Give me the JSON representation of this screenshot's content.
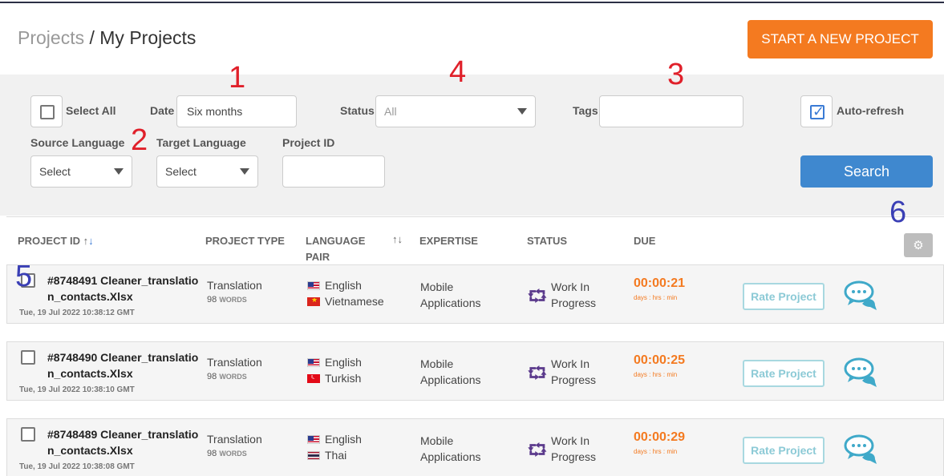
{
  "header": {
    "breadcrumb_parent": "Projects",
    "breadcrumb_sep": "/",
    "breadcrumb_current": "My Projects",
    "new_project_label": "START A NEW PROJECT"
  },
  "filters": {
    "select_all_label": "Select All",
    "date_label": "Date",
    "date_value": "Six months",
    "status_label": "Status",
    "status_value": "All",
    "tags_label": "Tags",
    "tags_value": "",
    "auto_refresh_label": "Auto-refresh",
    "auto_refresh_checked": true,
    "source_language_label": "Source Language",
    "source_language_value": "Select",
    "target_language_label": "Target Language",
    "target_language_value": "Select",
    "project_id_label": "Project ID",
    "project_id_value": "",
    "search_label": "Search"
  },
  "annotations": [
    "1",
    "2",
    "3",
    "4",
    "5",
    "6"
  ],
  "table": {
    "columns": {
      "project_id": "PROJECT ID",
      "project_type": "PROJECT TYPE",
      "language_pair_1": "LANGUAGE",
      "language_pair_2": "PAIR",
      "expertise": "EXPERTISE",
      "status": "STATUS",
      "due": "DUE"
    },
    "rows": [
      {
        "title": "#8748491 Cleaner_translation_contacts.Xlsx",
        "date": "Tue, 19 Jul 2022 10:38:12 GMT",
        "type": "Translation",
        "words": "98",
        "words_label": "WORDS",
        "source_lang": "English",
        "target_lang": "Vietnamese",
        "expertise_1": "Mobile",
        "expertise_2": "Applications",
        "status_1": "Work In",
        "status_2": "Progress",
        "due": "00:00:21",
        "due_label": "days : hrs : min",
        "rate_label": "Rate Project"
      },
      {
        "title": "#8748490 Cleaner_translation_contacts.Xlsx",
        "date": "Tue, 19 Jul 2022 10:38:10 GMT",
        "type": "Translation",
        "words": "98",
        "words_label": "WORDS",
        "source_lang": "English",
        "target_lang": "Turkish",
        "expertise_1": "Mobile",
        "expertise_2": "Applications",
        "status_1": "Work In",
        "status_2": "Progress",
        "due": "00:00:25",
        "due_label": "days : hrs : min",
        "rate_label": "Rate Project"
      },
      {
        "title": "#8748489 Cleaner_translation_contacts.Xlsx",
        "date": "Tue, 19 Jul 2022 10:38:08 GMT",
        "type": "Translation",
        "words": "98",
        "words_label": "WORDS",
        "source_lang": "English",
        "target_lang": "Thai",
        "expertise_1": "Mobile",
        "expertise_2": "Applications",
        "status_1": "Work In",
        "status_2": "Progress",
        "due": "00:00:29",
        "due_label": "days : hrs : min",
        "rate_label": "Rate Project"
      }
    ]
  },
  "colors": {
    "accent_orange": "#f47a20",
    "search_blue": "#3f88cf",
    "status_purple": "#5b3a8c",
    "chat_teal": "#3fa9c9"
  },
  "icons": {
    "checkbox": "checkbox-icon",
    "dropdown": "chevron-down-icon",
    "sort": "sort-arrows-icon",
    "gear": "gear-icon",
    "status": "work-in-progress-icon",
    "chat": "chat-bubbles-icon"
  }
}
